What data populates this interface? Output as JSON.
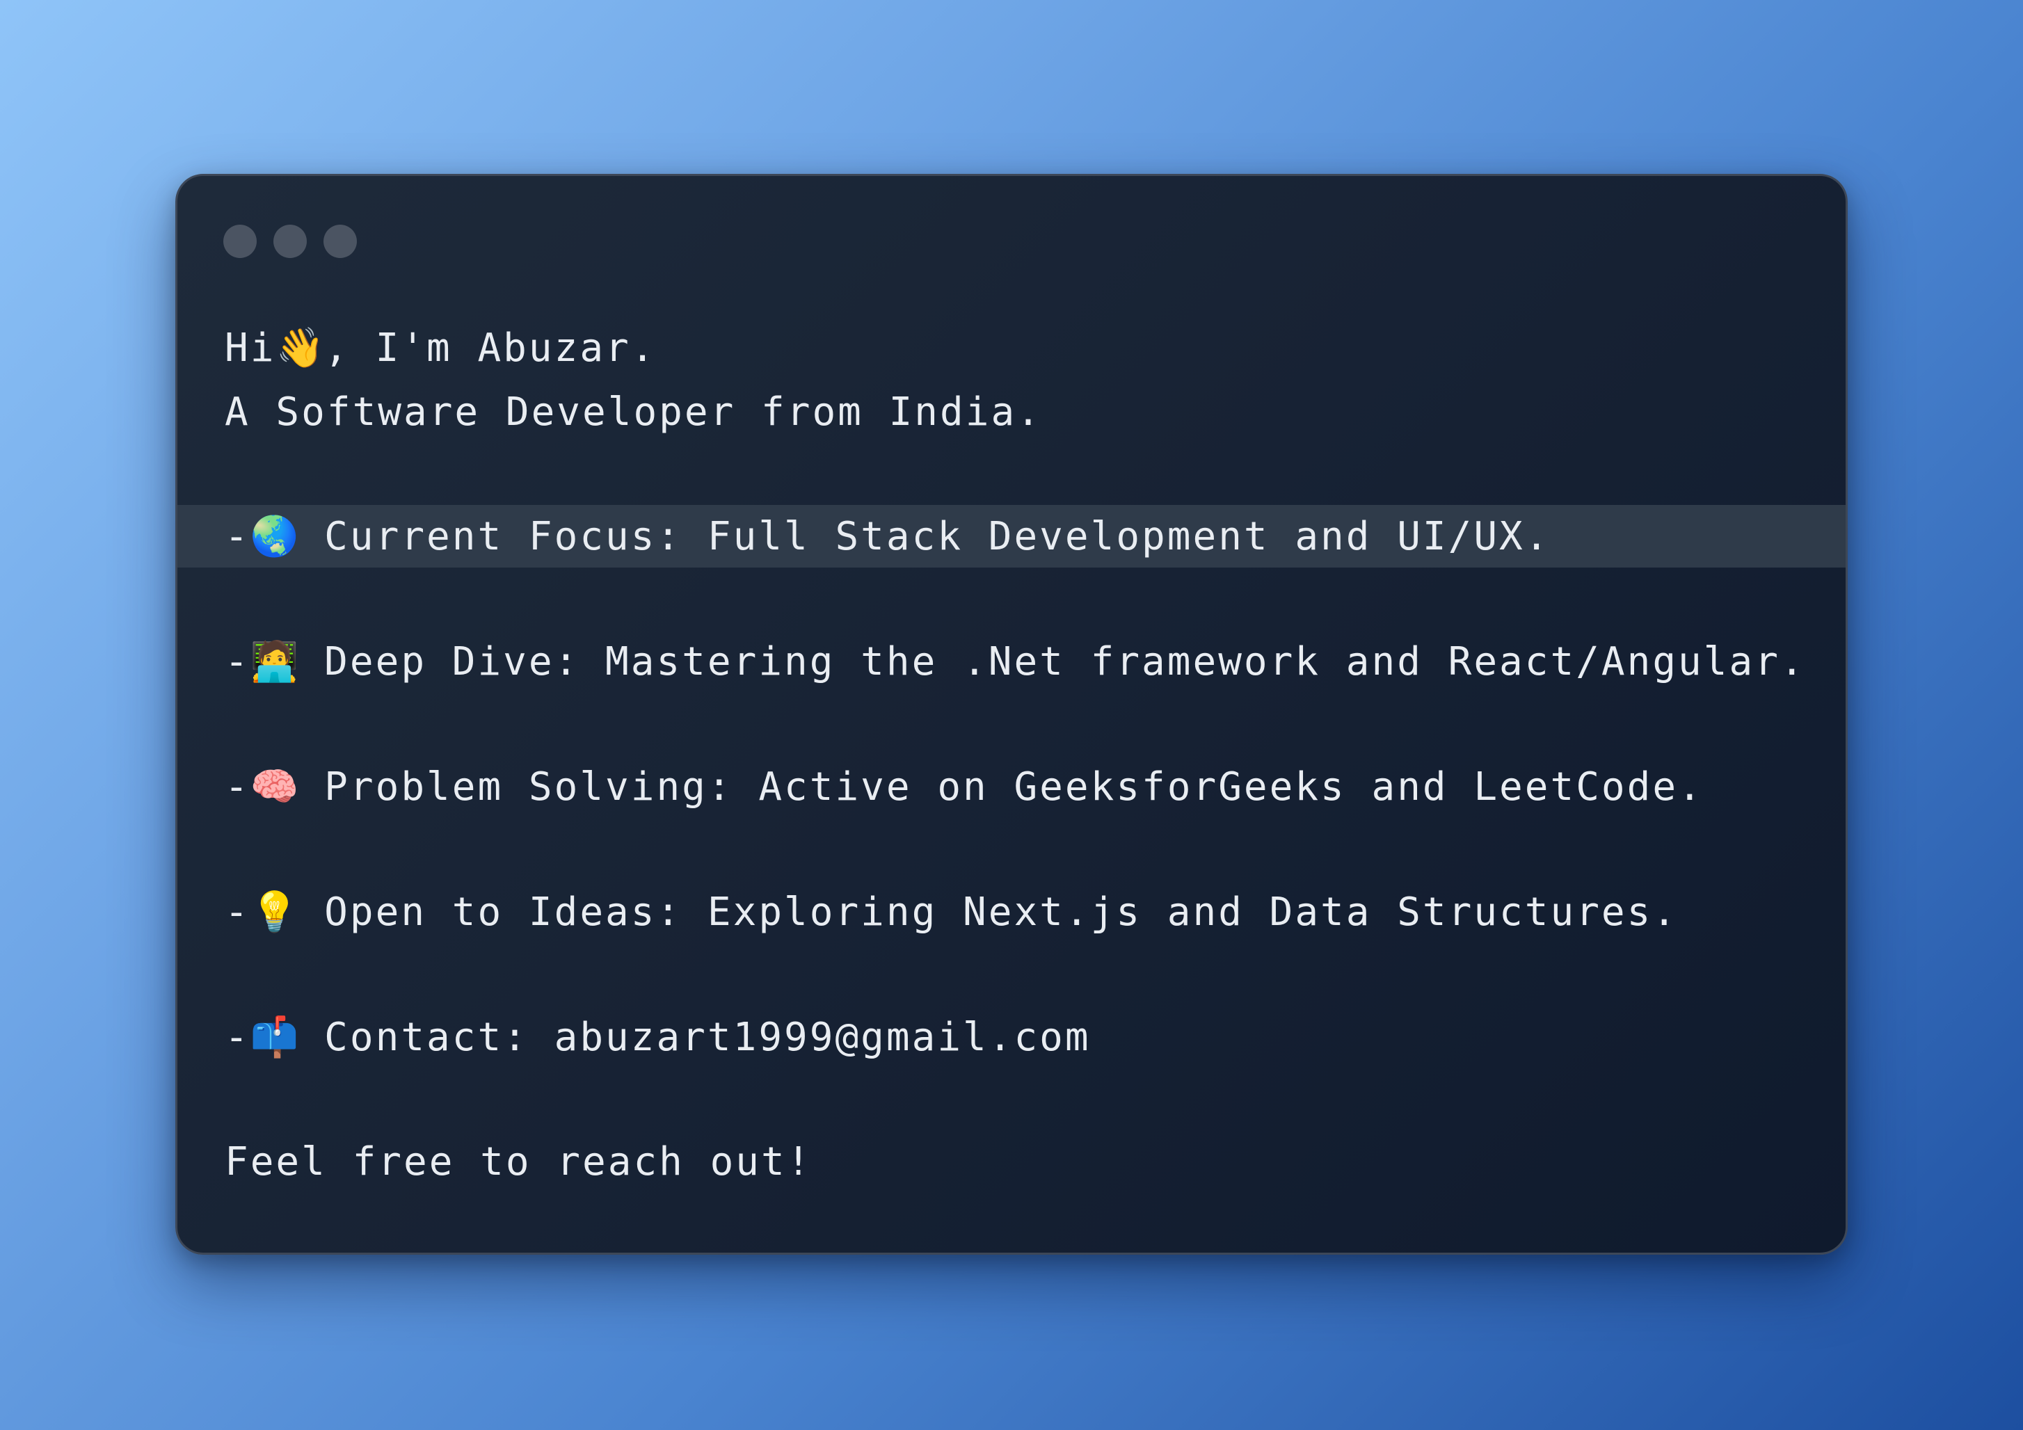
{
  "window": {
    "controls": [
      "close",
      "minimize",
      "maximize"
    ]
  },
  "intro": {
    "line1_prefix": "Hi",
    "wave_emoji": "👋",
    "line1_suffix": ", I'm Abuzar.",
    "line2": "A Software Developer from India."
  },
  "items": [
    {
      "bullet": "-",
      "emoji": "🌏",
      "icon": "globe-icon",
      "text": " Current Focus: Full Stack Development and UI/UX."
    },
    {
      "bullet": "-",
      "emoji": "🧑‍💻",
      "icon": "technologist-icon",
      "text": " Deep Dive: Mastering the .Net framework and React/Angular."
    },
    {
      "bullet": "-",
      "emoji": "🧠",
      "icon": "brain-icon",
      "text": " Problem Solving: Active on GeeksforGeeks and LeetCode."
    },
    {
      "bullet": "-",
      "emoji": "💡",
      "icon": "lightbulb-icon",
      "text": " Open to Ideas: Exploring Next.js and Data Structures."
    },
    {
      "bullet": "-",
      "emoji": "📫",
      "icon": "mailbox-icon",
      "text": " Contact: abuzart1999@gmail.com"
    }
  ],
  "outro": "Feel free to reach out!",
  "colors": {
    "background_start": "#8fc4f8",
    "background_end": "#1d4fa0",
    "window_bg": "#172234",
    "highlight_row": "#2f3b4a",
    "text": "#e9edf2",
    "dot": "#4b5462"
  }
}
